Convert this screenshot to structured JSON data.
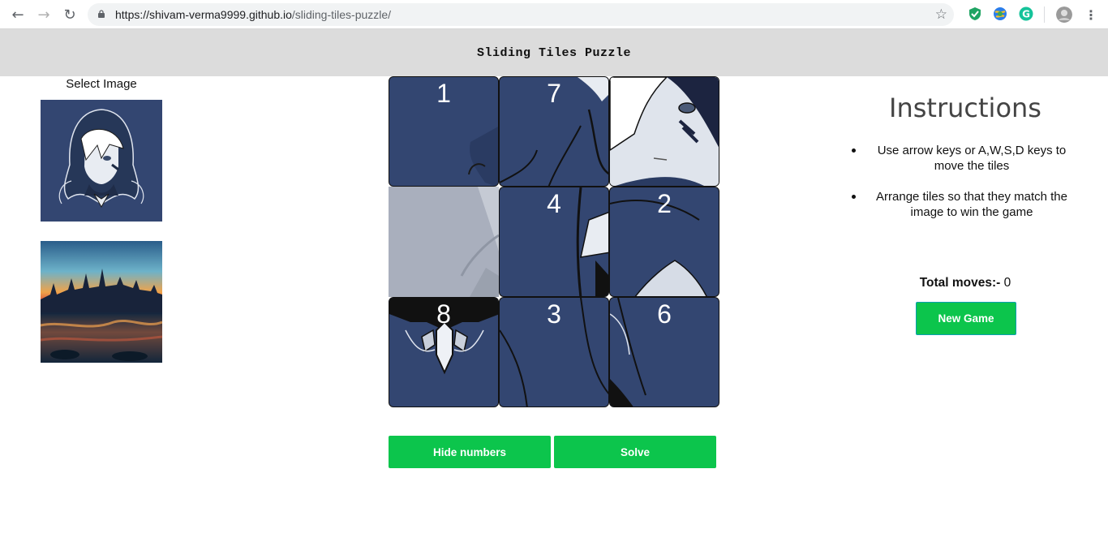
{
  "browser": {
    "url_host": "https://shivam-verma9999.github.io",
    "url_path": "/sliding-tiles-puzzle/"
  },
  "app": {
    "title": "Sliding Tiles Puzzle"
  },
  "image_select": {
    "heading": "Select Image",
    "images": [
      "anime-hooded-character",
      "castle-sunset-landscape"
    ]
  },
  "board": {
    "size": 3,
    "tiles": [
      {
        "label": "1"
      },
      {
        "label": "7"
      },
      {
        "label": ""
      },
      {
        "label": null
      },
      {
        "label": "4"
      },
      {
        "label": "2"
      },
      {
        "label": "8"
      },
      {
        "label": "3"
      },
      {
        "label": "6"
      }
    ],
    "empty_index": 3
  },
  "controls": {
    "hide_numbers_label": "Hide numbers",
    "solve_label": "Solve",
    "new_game_label": "New Game"
  },
  "instructions": {
    "title": "Instructions",
    "items": [
      "Use arrow keys or A,W,S,D keys to move the tiles",
      "Arrange tiles so that they match the image to win the game"
    ]
  },
  "stats": {
    "moves_label": "Total moves:-",
    "moves_value": "0"
  },
  "colors": {
    "accent": "#0cc54c",
    "tile": "#334671",
    "header_bg": "#dcdcdc"
  }
}
